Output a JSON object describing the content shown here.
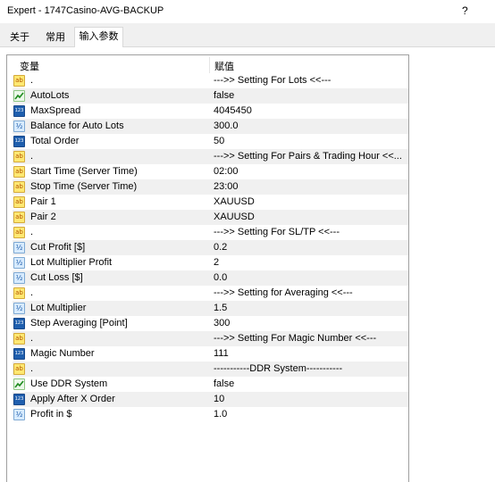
{
  "window": {
    "title": "Expert - 1747Casino-AVG-BACKUP",
    "help": "?"
  },
  "tabs": [
    {
      "label": "关于",
      "active": false
    },
    {
      "label": "常用",
      "active": false
    },
    {
      "label": "输入参数",
      "active": true
    }
  ],
  "table": {
    "headers": {
      "variable": "变量",
      "value": "赋值"
    },
    "rows": [
      {
        "icon": "text-icon",
        "name": ".",
        "value": "--->> Setting For Lots <<---"
      },
      {
        "icon": "bool-icon",
        "name": "AutoLots",
        "value": "false"
      },
      {
        "icon": "integer-icon",
        "name": "MaxSpread",
        "value": "4045450"
      },
      {
        "icon": "double-icon",
        "name": "Balance for Auto Lots",
        "value": "300.0"
      },
      {
        "icon": "integer-icon",
        "name": "Total Order",
        "value": "50"
      },
      {
        "icon": "text-icon",
        "name": ".",
        "value": "--->> Setting For Pairs & Trading Hour <<..."
      },
      {
        "icon": "text-icon",
        "name": "Start Time (Server Time)",
        "value": "02:00"
      },
      {
        "icon": "text-icon",
        "name": "Stop Time (Server Time)",
        "value": "23:00"
      },
      {
        "icon": "text-icon",
        "name": "Pair 1",
        "value": "XAUUSD"
      },
      {
        "icon": "text-icon",
        "name": "Pair 2",
        "value": "XAUUSD"
      },
      {
        "icon": "text-icon",
        "name": ".",
        "value": "--->> Setting For SL/TP <<---"
      },
      {
        "icon": "double-icon",
        "name": "Cut Profit [$]",
        "value": "0.2"
      },
      {
        "icon": "double-icon",
        "name": "Lot Multiplier Profit",
        "value": "2"
      },
      {
        "icon": "double-icon",
        "name": "Cut Loss [$]",
        "value": "0.0"
      },
      {
        "icon": "text-icon",
        "name": ".",
        "value": "--->> Setting for Averaging  <<---"
      },
      {
        "icon": "double-icon",
        "name": "Lot Multiplier",
        "value": "1.5"
      },
      {
        "icon": "integer-icon",
        "name": "Step Averaging [Point]",
        "value": "300"
      },
      {
        "icon": "text-icon",
        "name": ".",
        "value": "--->> Setting For Magic Number <<---"
      },
      {
        "icon": "integer-icon",
        "name": "Magic Number",
        "value": "111"
      },
      {
        "icon": "text-icon",
        "name": ".",
        "value": "-----------DDR System-----------"
      },
      {
        "icon": "bool-icon",
        "name": "Use DDR System",
        "value": "false"
      },
      {
        "icon": "integer-icon",
        "name": "Apply After X Order",
        "value": "10"
      },
      {
        "icon": "double-icon",
        "name": "Profit in $",
        "value": "1.0"
      }
    ]
  }
}
